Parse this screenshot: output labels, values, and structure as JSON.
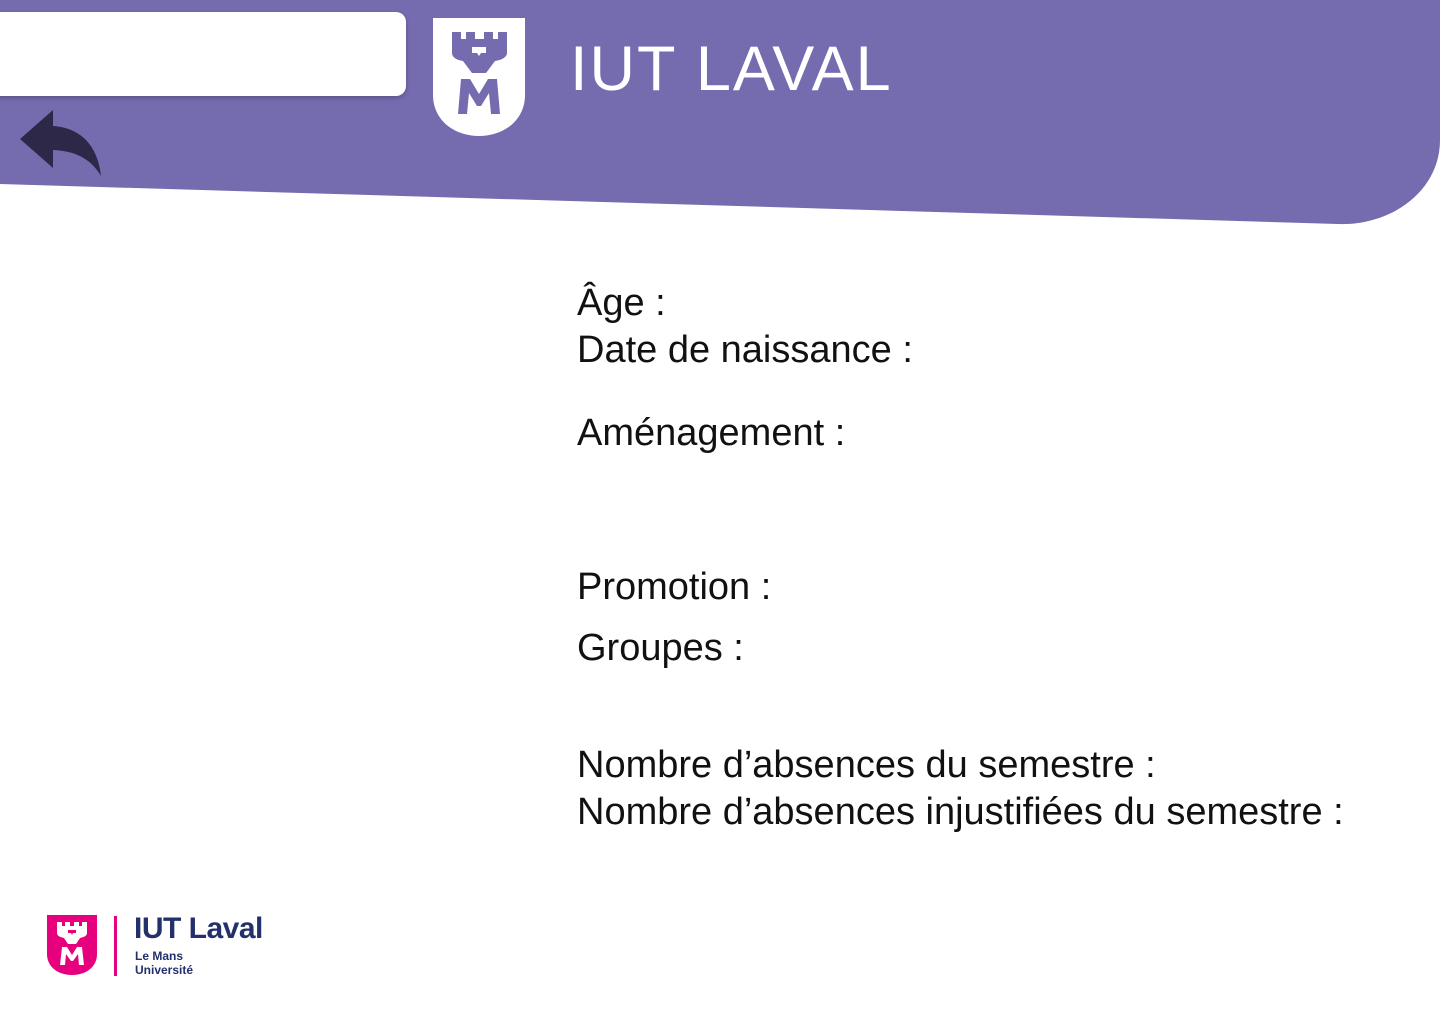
{
  "header": {
    "title": "IUT LAVAL",
    "back_icon": "reply-arrow-icon",
    "logo_icon": "le-mans-universite-shield-icon",
    "search": {
      "value": "",
      "placeholder": ""
    }
  },
  "student_info": {
    "age_label": "Âge :",
    "birth_date_label": "Date de naissance :",
    "amenagement_label": "Aménagement :",
    "promotion_label": "Promotion :",
    "groups_label": "Groupes :",
    "absences_label": "Nombre d’absences du semestre :",
    "unjustified_absences_label": "Nombre d’absences injustifiées du semestre :"
  },
  "footer": {
    "logo_name": "IUT Laval",
    "logo_sub_line1": "Le Mans",
    "logo_sub_line2": "Université",
    "logo_icon": "le-mans-universite-shield-icon"
  },
  "colors": {
    "header_band": "#756baf",
    "back_arrow": "#2e2848",
    "shield_fill": "#ffffff",
    "shield_mark": "#756baf",
    "footer_brand_pink": "#e6007e",
    "footer_brand_navy": "#24306b",
    "text": "#111111"
  }
}
